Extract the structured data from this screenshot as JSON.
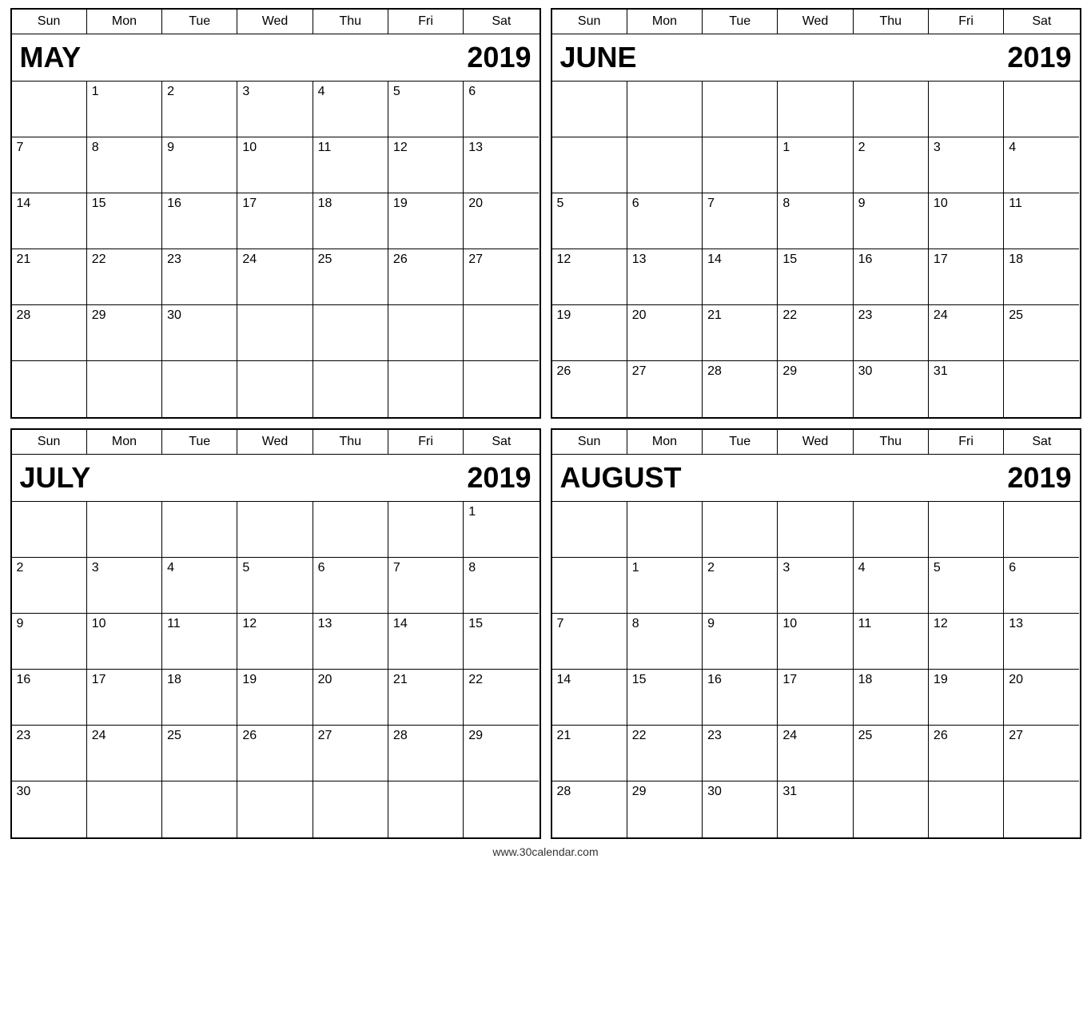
{
  "footer": {
    "text": "www.30calendar.com"
  },
  "dayNames": [
    "Sun",
    "Mon",
    "Tue",
    "Wed",
    "Thu",
    "Fri",
    "Sat"
  ],
  "calendars": [
    {
      "id": "may-2019",
      "month": "MAY",
      "year": "2019",
      "weeks": [
        [
          "",
          "1",
          "2",
          "3",
          "4",
          "5",
          "6"
        ],
        [
          "7",
          "8",
          "9",
          "10",
          "11",
          "12",
          "13"
        ],
        [
          "14",
          "15",
          "16",
          "17",
          "18",
          "19",
          "20"
        ],
        [
          "21",
          "22",
          "23",
          "24",
          "25",
          "26",
          "27"
        ],
        [
          "28",
          "29",
          "30",
          "",
          "",
          "",
          ""
        ],
        [
          "",
          "",
          "",
          "",
          "",
          "",
          ""
        ]
      ]
    },
    {
      "id": "june-2019",
      "month": "JUNE",
      "year": "2019",
      "weeks": [
        [
          "",
          "",
          "",
          "",
          "",
          "",
          ""
        ],
        [
          "",
          "",
          "",
          "1",
          "2",
          "3",
          "4"
        ],
        [
          "5",
          "6",
          "7",
          "8",
          "9",
          "10",
          "11"
        ],
        [
          "12",
          "13",
          "14",
          "15",
          "16",
          "17",
          "18"
        ],
        [
          "19",
          "20",
          "21",
          "22",
          "23",
          "24",
          "25"
        ],
        [
          "26",
          "27",
          "28",
          "29",
          "30",
          "31",
          ""
        ]
      ]
    },
    {
      "id": "july-2019",
      "month": "JULY",
      "year": "2019",
      "weeks": [
        [
          "",
          "",
          "",
          "",
          "",
          "",
          "1"
        ],
        [
          "2",
          "3",
          "4",
          "5",
          "6",
          "7",
          "8"
        ],
        [
          "9",
          "10",
          "11",
          "12",
          "13",
          "14",
          "15"
        ],
        [
          "16",
          "17",
          "18",
          "19",
          "20",
          "21",
          "22"
        ],
        [
          "23",
          "24",
          "25",
          "26",
          "27",
          "28",
          "29"
        ],
        [
          "30",
          "",
          "",
          "",
          "",
          "",
          ""
        ]
      ]
    },
    {
      "id": "august-2019",
      "month": "AUGUST",
      "year": "2019",
      "weeks": [
        [
          "",
          "",
          "",
          "",
          "",
          "",
          ""
        ],
        [
          "",
          "1",
          "2",
          "3",
          "4",
          "5",
          "6"
        ],
        [
          "7",
          "8",
          "9",
          "10",
          "11",
          "12",
          "13"
        ],
        [
          "14",
          "15",
          "16",
          "17",
          "18",
          "19",
          "20"
        ],
        [
          "21",
          "22",
          "23",
          "24",
          "25",
          "26",
          "27"
        ],
        [
          "28",
          "29",
          "30",
          "31",
          "",
          "",
          ""
        ]
      ]
    }
  ]
}
